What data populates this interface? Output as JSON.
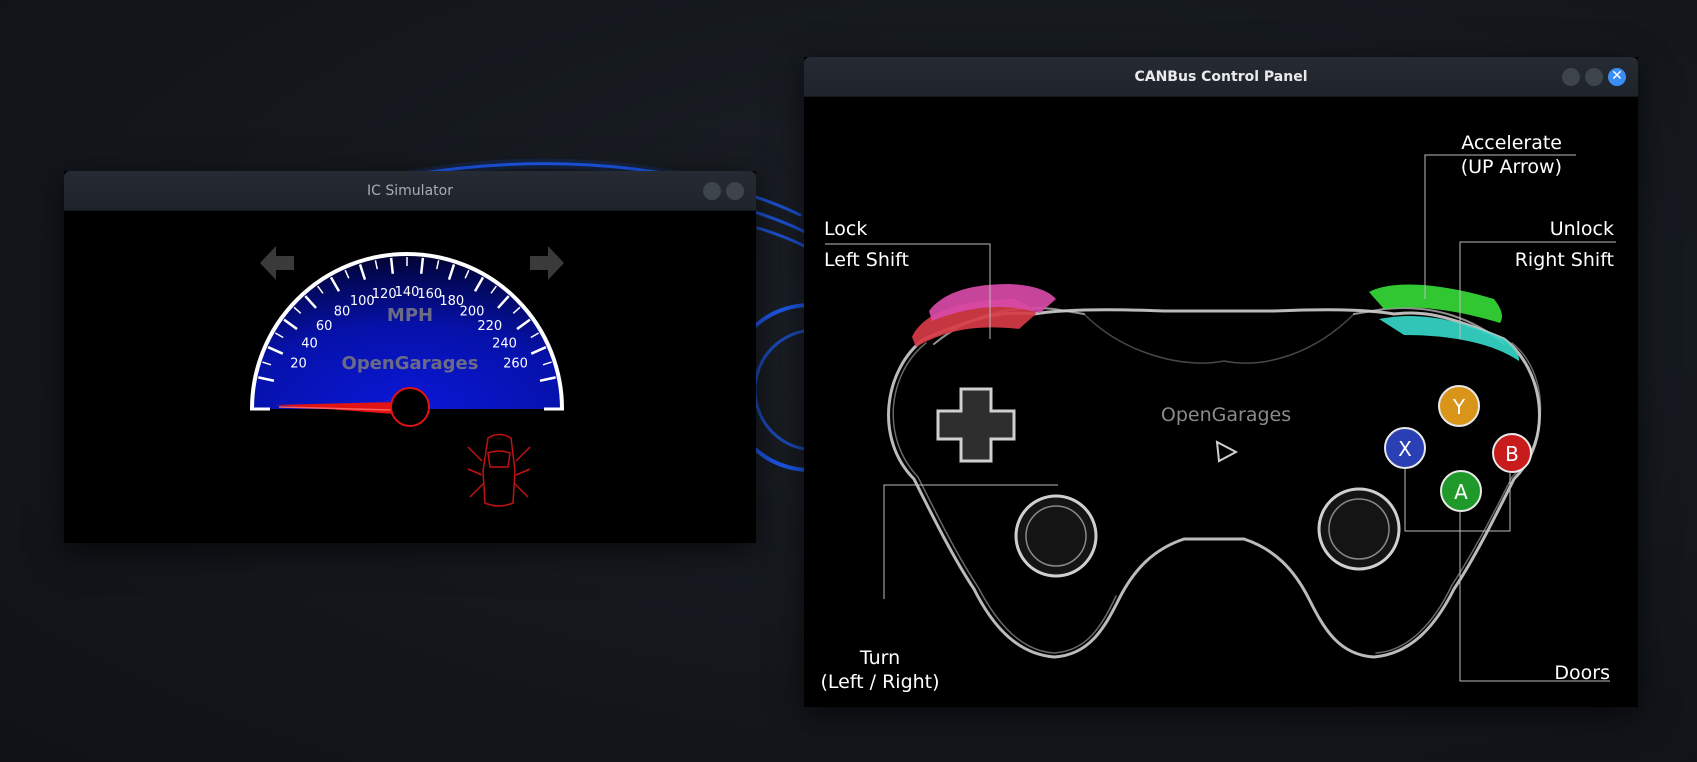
{
  "ic_simulator": {
    "title": "IC Simulator",
    "speedometer": {
      "unit": "MPH",
      "brand": "OpenGarages",
      "tick_labels": [
        "20",
        "40",
        "60",
        "80",
        "100",
        "120",
        "140",
        "160",
        "180",
        "200",
        "220",
        "240",
        "260"
      ],
      "speed_value": 0
    },
    "left_arrow_icon": "arrow-left-icon",
    "right_arrow_icon": "arrow-right-icon",
    "car_icon": "car-doors-icon"
  },
  "control_panel": {
    "title": "CANBus Control Panel",
    "brand": "OpenGarages",
    "face_buttons": {
      "y": "Y",
      "x": "X",
      "b": "B",
      "a": "A"
    },
    "labels": {
      "lock": "Lock",
      "left_shift": "Left Shift",
      "accelerate": "Accelerate",
      "up_arrow": "(UP Arrow)",
      "unlock": "Unlock",
      "right_shift": "Right Shift",
      "turn": "Turn",
      "turn_keys": "(Left / Right)",
      "doors": "Doors"
    },
    "close_glyph": "✕"
  },
  "colors": {
    "accent_blue": "#3a8ef6",
    "needle_red": "#e11313",
    "gauge_blue": "#0a18d8",
    "bumper_pink": "#d84aa8",
    "bumper_red": "#d63b45",
    "bumper_green": "#35d836",
    "bumper_cyan": "#35d6c8",
    "button_yellow": "#d9951a",
    "button_blue": "#2a3fb3",
    "button_red": "#c81b1b",
    "button_green": "#1f9a2a"
  }
}
